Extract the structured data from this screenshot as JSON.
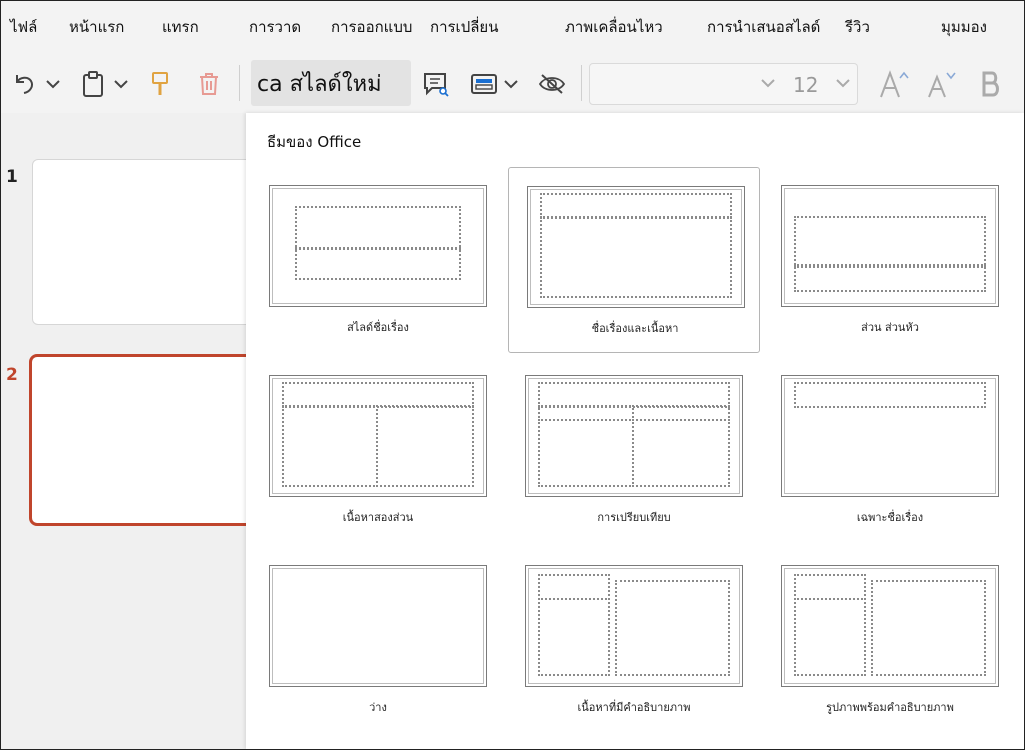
{
  "menu": {
    "items": [
      "ไฟล์",
      "หน้าแรก",
      "แทรก",
      "การวาด",
      "การออกแบบ",
      "การเปลี่ยน",
      "ภาพเคลื่อนไหว",
      "การนำเสนอสไลด์",
      "รีวิว",
      "มุมมอง"
    ]
  },
  "toolbar": {
    "new_slide_label": "ca สไลด์ใหม่",
    "font_size": "12"
  },
  "slides": {
    "numbers": [
      "1",
      "2"
    ],
    "active_index": 2
  },
  "gallery": {
    "title": "ธีมของ Office",
    "layouts": [
      {
        "label": "สไลด์ชื่อเรื่อง"
      },
      {
        "label": "ชื่อเรื่องและเนื้อหา"
      },
      {
        "label": "ส่วน         ส่วนหัว"
      },
      {
        "label": "เนื้อหาสองส่วน"
      },
      {
        "label": "การเปรียบเทียบ"
      },
      {
        "label": "เฉพาะชื่อเรื่อง"
      },
      {
        "label": "ว่าง"
      },
      {
        "label": "เนื้อหาที่มีคำอธิบายภาพ"
      },
      {
        "label": "รูปภาพพร้อมคำอธิบายภาพ"
      }
    ]
  },
  "colors": {
    "active_slide_border": "#c0452c",
    "gallery_background": "#ffffff",
    "chrome_background": "#f3f3f3"
  }
}
